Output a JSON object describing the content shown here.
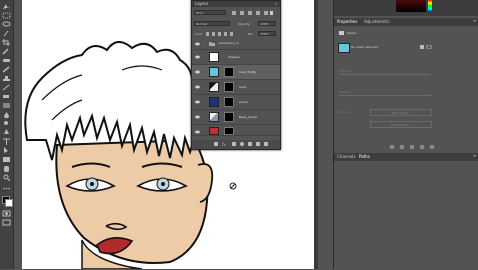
{
  "layers_panel": {
    "title": "Layers",
    "filter_kind": "Kind",
    "blend_mode": "Normal",
    "opacity_label": "Opacity:",
    "opacity_value": "100%",
    "lock_label": "Lock:",
    "fill_label": "Fill:",
    "fill_value": "100%",
    "layers": [
      {
        "name": "colortheory_1",
        "type": "group"
      },
      {
        "name": "Glasses",
        "type": "layer",
        "thumb": "#ffffff"
      },
      {
        "name": "head_Eaftg",
        "type": "layer",
        "thumb": "#66c6e0",
        "selected": true
      },
      {
        "name": "hair1",
        "type": "layer",
        "thumb": "#dddddd"
      },
      {
        "name": "shoes",
        "type": "layer",
        "thumb": "#1f2f78"
      },
      {
        "name": "Base_Jacket",
        "type": "layer",
        "thumb": "#8899aa"
      },
      {
        "name": "",
        "type": "layer",
        "thumb": "#c0303a"
      }
    ]
  },
  "properties_panel": {
    "tabs": [
      "Properties",
      "Adjustments"
    ],
    "subtitle": "Masks",
    "status": "No mask selected",
    "density_label": "Density:",
    "feather_label": "Feather:",
    "refine_label": "Refine:",
    "mask_edge_button": "Mask Edge...",
    "invert_button": "Color Range..."
  },
  "bottom_panel": {
    "tabs": [
      "Channels",
      "Paths"
    ]
  },
  "colors": {
    "skin": "#eecba7",
    "eye_iris": "#b9d9e2",
    "lips": "#b22a2a",
    "hair": "#ffffff",
    "outline": "#111111"
  }
}
